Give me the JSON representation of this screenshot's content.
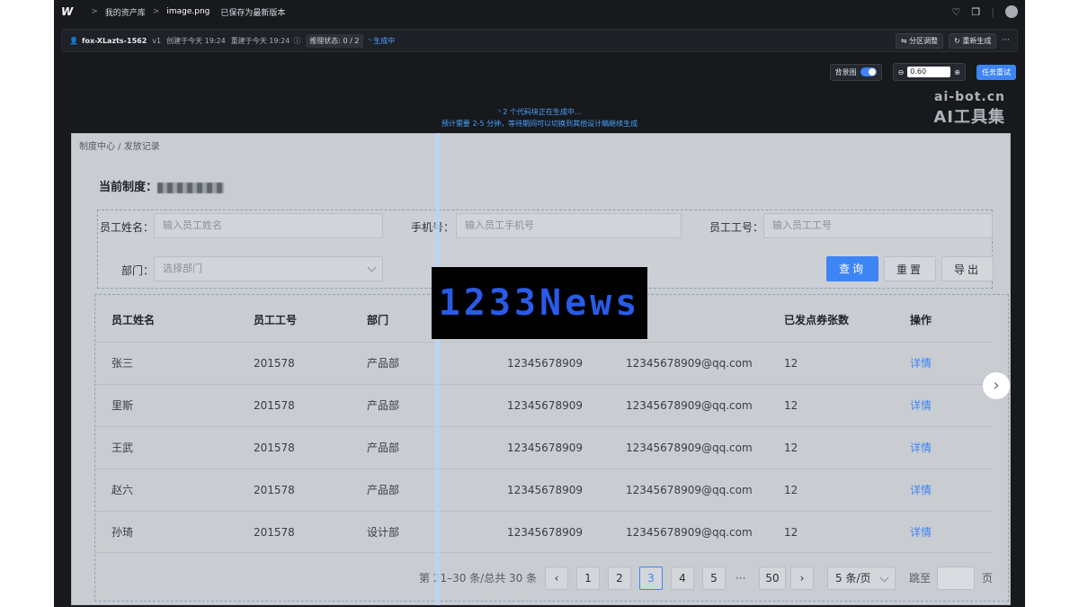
{
  "topbar": {
    "logo": "W",
    "crumb1": "我的资产库",
    "crumb2": "image.png",
    "saved": "已保存为最新版本"
  },
  "infobar": {
    "project": "fox-XLazts-1562",
    "version": "v1",
    "created": "创建于今天 19:24",
    "updated": "重建于今天 19:24",
    "reasoning": "推理状态: 0 / 2",
    "generating": "生成中",
    "partition_btn": "分区调整",
    "regen_btn": "重新生成",
    "more": "···"
  },
  "controls": {
    "bg_label": "背景图",
    "zoom_value": "0.60",
    "task_btn": "任务重试"
  },
  "status": {
    "line1": "2 个代码块正在生成中...",
    "line2": "预计需要 2-5 分钟，等待期间可以切换到其他设计稿继续生成"
  },
  "watermark": {
    "line1": "ai-bot.cn",
    "line2": "AI工具集"
  },
  "page": {
    "breadcrumb": "制度中心  /  发放记录",
    "current_label": "当前制度：",
    "form": {
      "name_label": "员工姓名：",
      "name_placeholder": "输入员工姓名",
      "phone_label": "手机号：",
      "phone_placeholder": "输入员工手机号",
      "id_label": "员工工号：",
      "id_placeholder": "输入员工工号",
      "dept_label": "部门：",
      "dept_placeholder": "选择部门",
      "query": "查询",
      "reset": "重置",
      "export": "导出"
    },
    "table": {
      "headers": [
        "员工姓名",
        "员工工号",
        "部门",
        "",
        "",
        "已发点券张数",
        "操作"
      ],
      "rows": [
        [
          "张三",
          "201578",
          "产品部",
          "12345678909",
          "12345678909@qq.com",
          "12",
          "详情"
        ],
        [
          "里斯",
          "201578",
          "产品部",
          "12345678909",
          "12345678909@qq.com",
          "12",
          "详情"
        ],
        [
          "王武",
          "201578",
          "产品部",
          "12345678909",
          "12345678909@qq.com",
          "12",
          "详情"
        ],
        [
          "赵六",
          "201578",
          "产品部",
          "12345678909",
          "12345678909@qq.com",
          "12",
          "详情"
        ],
        [
          "孙琦",
          "201578",
          "设计部",
          "12345678909",
          "12345678909@qq.com",
          "12",
          "详情"
        ]
      ]
    },
    "pager": {
      "summary": "第 21–30 条/总共 30 条",
      "pages": [
        "1",
        "2",
        "3",
        "4",
        "5"
      ],
      "ellipsis": "···",
      "last": "50",
      "active": "3",
      "size": "5 条/页",
      "jump": "跳至",
      "page_unit": "页"
    }
  },
  "overlay": {
    "news": "1233News"
  }
}
